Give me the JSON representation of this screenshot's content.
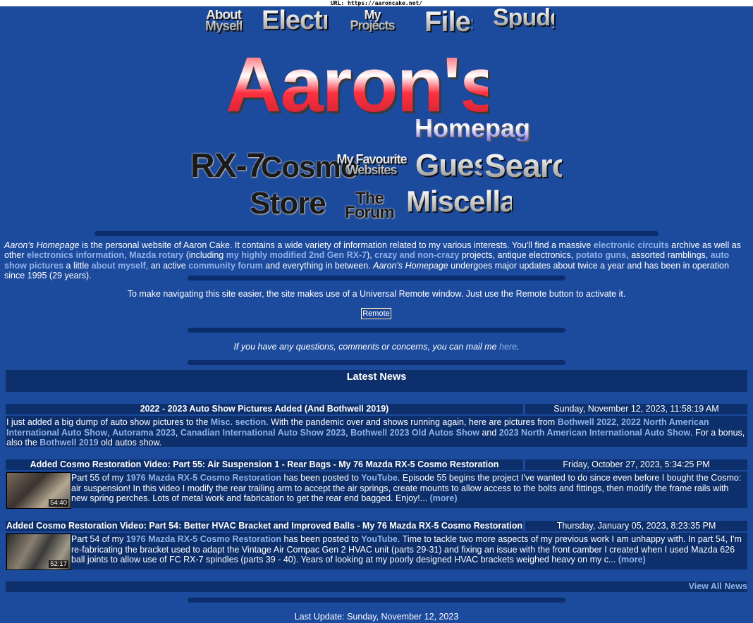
{
  "url_bar": "URL: https://aaroncake.net/",
  "top_nav": [
    {
      "label": "About\nMyself"
    },
    {
      "label": "Electronics"
    },
    {
      "label": "My\nProjects"
    },
    {
      "label": "Files"
    },
    {
      "label": "Spudguns"
    }
  ],
  "title": {
    "main": "Aaron's",
    "sub": "Homepage"
  },
  "main_nav_row1": [
    {
      "label": "RX-7"
    },
    {
      "label": "Cosmo"
    },
    {
      "label": "My Favourite\nWebsites"
    },
    {
      "label": "Guestbook"
    },
    {
      "label": "Search"
    }
  ],
  "main_nav_row2": [
    {
      "label": "Store"
    },
    {
      "label": "The\nForum"
    },
    {
      "label": "Miscellaneous"
    }
  ],
  "intro": {
    "site_name": "Aaron's Homepage",
    "t1": " is the personal website of Aaron Cake. It contains a wide variety of information related to my various interests. You'll find a massive ",
    "link1": "electronic circuits",
    "t2": " archive as well as other ",
    "link2": "electronics information",
    "t3": ", ",
    "link3": "Mazda rotary",
    "t4": " (including ",
    "link4": "my highly modified 2nd Gen RX-7",
    "t5": "), ",
    "link5": "crazy and non-crazy",
    "t6": " projects, antique electronics, ",
    "link6": "potato guns",
    "t7": ", assorted ramblings, ",
    "link7": "auto show pictures",
    "t8": " a little ",
    "link8": "about myself",
    "t9": ", an active ",
    "link9": "community forum",
    "t10": " and everything in between. ",
    "site_name2": "Aaron's Homepage",
    "t11": " undergoes major updates about twice a year and has been in operation since 1995 (29 years)."
  },
  "remote_text": "To make navigating this site easier, the site makes use of a Universal Remote window. Just use the Remote button to activate it.",
  "remote_button": "Remote",
  "mail_text": "If you have any questions, comments or concerns, you can mail me ",
  "mail_link": "here",
  "mail_end": ".",
  "latest_news_title": "Latest News",
  "news": [
    {
      "title": "2022 - 2023 Auto Show Pictures Added (And Bothwell 2019)",
      "date": "Sunday, November 12, 2023, 11:58:19 AM",
      "b1": "I just added a big dump of auto show pictures to the ",
      "l1": "Misc. section",
      "b2": ". With the pandemic over and shows running again, here are pictures from ",
      "l2": "Bothwell 2022",
      "b3": ", ",
      "l3": "2022 North American International Auto Show",
      "b4": ", ",
      "l4": "Autorama 2023",
      "b5": ", ",
      "l5": "Canadian International Auto Show 2023",
      "b6": ", ",
      "l6": "Bothwell 2023 Old Autos Show",
      "b7": " and ",
      "l7": "2023 North American International Auto Show",
      "b8": ". For a bonus, also the ",
      "l8": "Bothwell 2019",
      "b9": " old autos show."
    },
    {
      "title": "Added Cosmo Restoration Video: Part 55: Air Suspension 1 - Rear Bags - My 76 Mazda RX-5 Cosmo Restoration",
      "date": "Friday, October 27, 2023, 5:34:25 PM",
      "duration": "54:40",
      "b1": "Part 55 of my ",
      "l1": "1976 Mazda RX-5 Cosmo Restoration",
      "b2": " has been posted to ",
      "l2": "YouTube",
      "b3": ". Episode 55 begins the project I've wanted to do since even before I bought the Cosmo: air suspension! In this video I modify the rear trailing arm to accept the air springs, create mounts to allow access to the bolts and fittings, then modify the frame rails with new spring perches. Lots of metal work and fabrication to get the rear end bagged. Enjoy!... ",
      "more": "(more)"
    },
    {
      "title": "Added Cosmo Restoration Video: Part 54: Better HVAC Bracket and Improved Balls - My 76 Mazda RX-5 Cosmo Restoration",
      "date": "Thursday, January 05, 2023, 8:23:35 PM",
      "duration": "52:17",
      "b1": "Part 54 of my ",
      "l1": "1976 Mazda RX-5 Cosmo Restoration",
      "b2": " has been posted to ",
      "l2": "YouTube",
      "b3": ". Time to tackle two more aspects of my previous work I am unhappy with. In part 54, I'm re-fabricating the bracket used to adapt the Vintage Air Compac Gen 2 HVAC unit (parts 29-31) and fixing an issue with the front camber I created when I used Mazda 626 ball joints to allow use of FC RX-7 spindles (parts 39 - 40). Years of looking at my poorly designed HVAC brackets weighed heavy on my c... ",
      "more": "(more)"
    }
  ],
  "view_all_news": "View All News",
  "last_update": "Last Update: Sunday, November 12, 2023"
}
